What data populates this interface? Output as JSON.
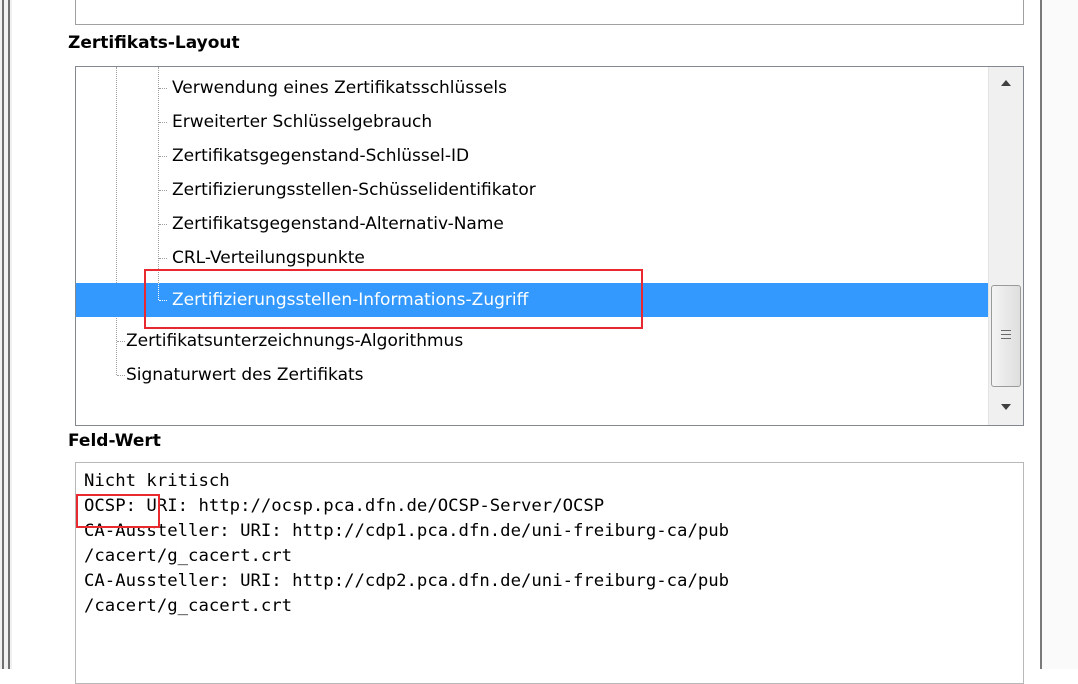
{
  "sections": {
    "layout_label": "Zertifikats-Layout",
    "value_label": "Feld-Wert"
  },
  "tree": {
    "items": [
      {
        "label": "Verwendung eines Zertifikatsschlüssels",
        "level": 2,
        "selected": false
      },
      {
        "label": "Erweiterter Schlüsselgebrauch",
        "level": 2,
        "selected": false
      },
      {
        "label": "Zertifikatsgegenstand-Schlüssel-ID",
        "level": 2,
        "selected": false
      },
      {
        "label": "Zertifizierungsstellen-Schüsselidentifikator",
        "level": 2,
        "selected": false
      },
      {
        "label": "Zertifikatsgegenstand-Alternativ-Name",
        "level": 2,
        "selected": false
      },
      {
        "label": "CRL-Verteilungspunkte",
        "level": 2,
        "selected": false
      },
      {
        "label": "Zertifizierungsstellen-Informations-Zugriff",
        "level": 2,
        "selected": true
      },
      {
        "label": "Zertifikatsunterzeichnungs-Algorithmus",
        "level": 1,
        "selected": false
      },
      {
        "label": "Signaturwert des Zertifikats",
        "level": 1,
        "selected": false
      }
    ]
  },
  "field_value": {
    "lines": [
      "Nicht kritisch",
      "OCSP: URI: http://ocsp.pca.dfn.de/OCSP-Server/OCSP",
      "CA-Aussteller: URI: http://cdp1.pca.dfn.de/uni-freiburg-ca/pub",
      "/cacert/g_cacert.crt",
      "CA-Aussteller: URI: http://cdp2.pca.dfn.de/uni-freiburg-ca/pub",
      "/cacert/g_cacert.crt"
    ]
  },
  "colors": {
    "selection": "#3399ff",
    "annotation": "#e8292f"
  },
  "icons": [
    "scroll-up-arrow-icon",
    "scroll-down-arrow-icon",
    "scroll-grip-icon"
  ]
}
